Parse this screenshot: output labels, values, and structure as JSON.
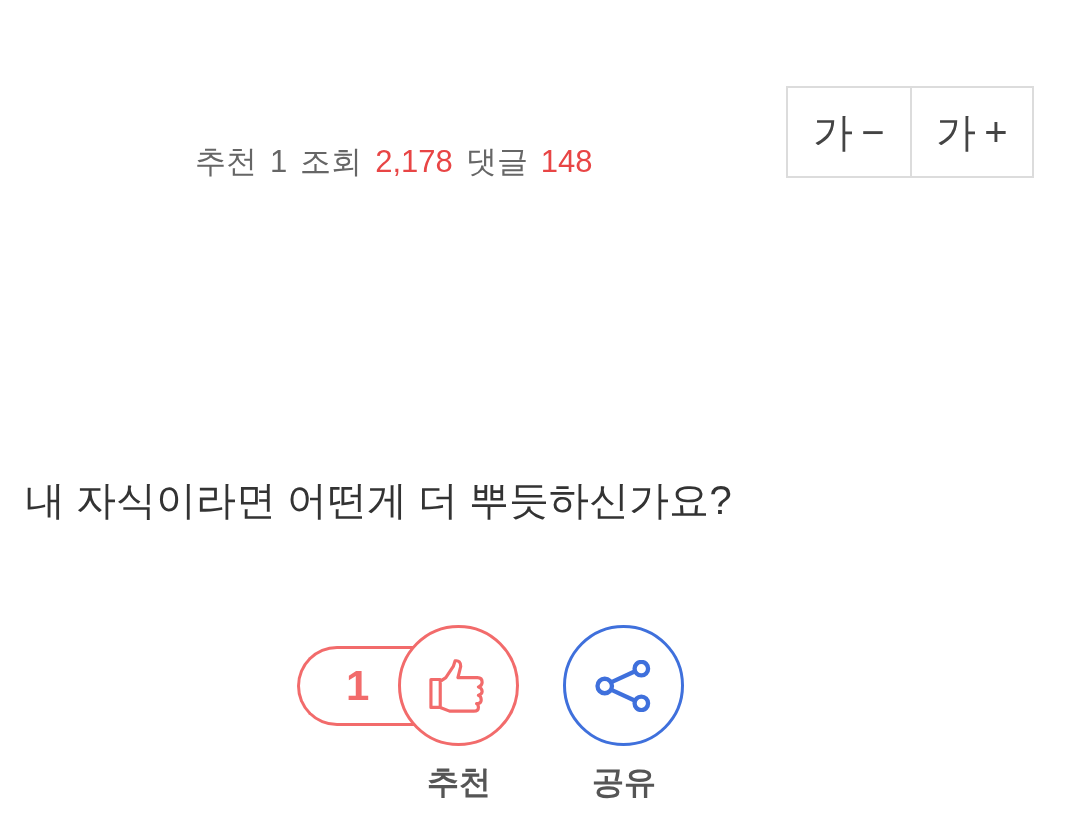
{
  "stats": [
    {
      "label": "추천",
      "value": "1",
      "highlighted": false
    },
    {
      "label": "조회",
      "value": "2,178",
      "highlighted": true
    },
    {
      "label": "댓글",
      "value": "148",
      "highlighted": true
    }
  ],
  "font_size_buttons": [
    {
      "label": "가−"
    },
    {
      "label": "가+"
    }
  ],
  "question": "내 자식이라면 어떤게 더 뿌듯하신가요?",
  "actions": [
    {
      "kind": "recommend",
      "count": "1",
      "label": "추천"
    },
    {
      "kind": "share",
      "label": "공유"
    }
  ]
}
